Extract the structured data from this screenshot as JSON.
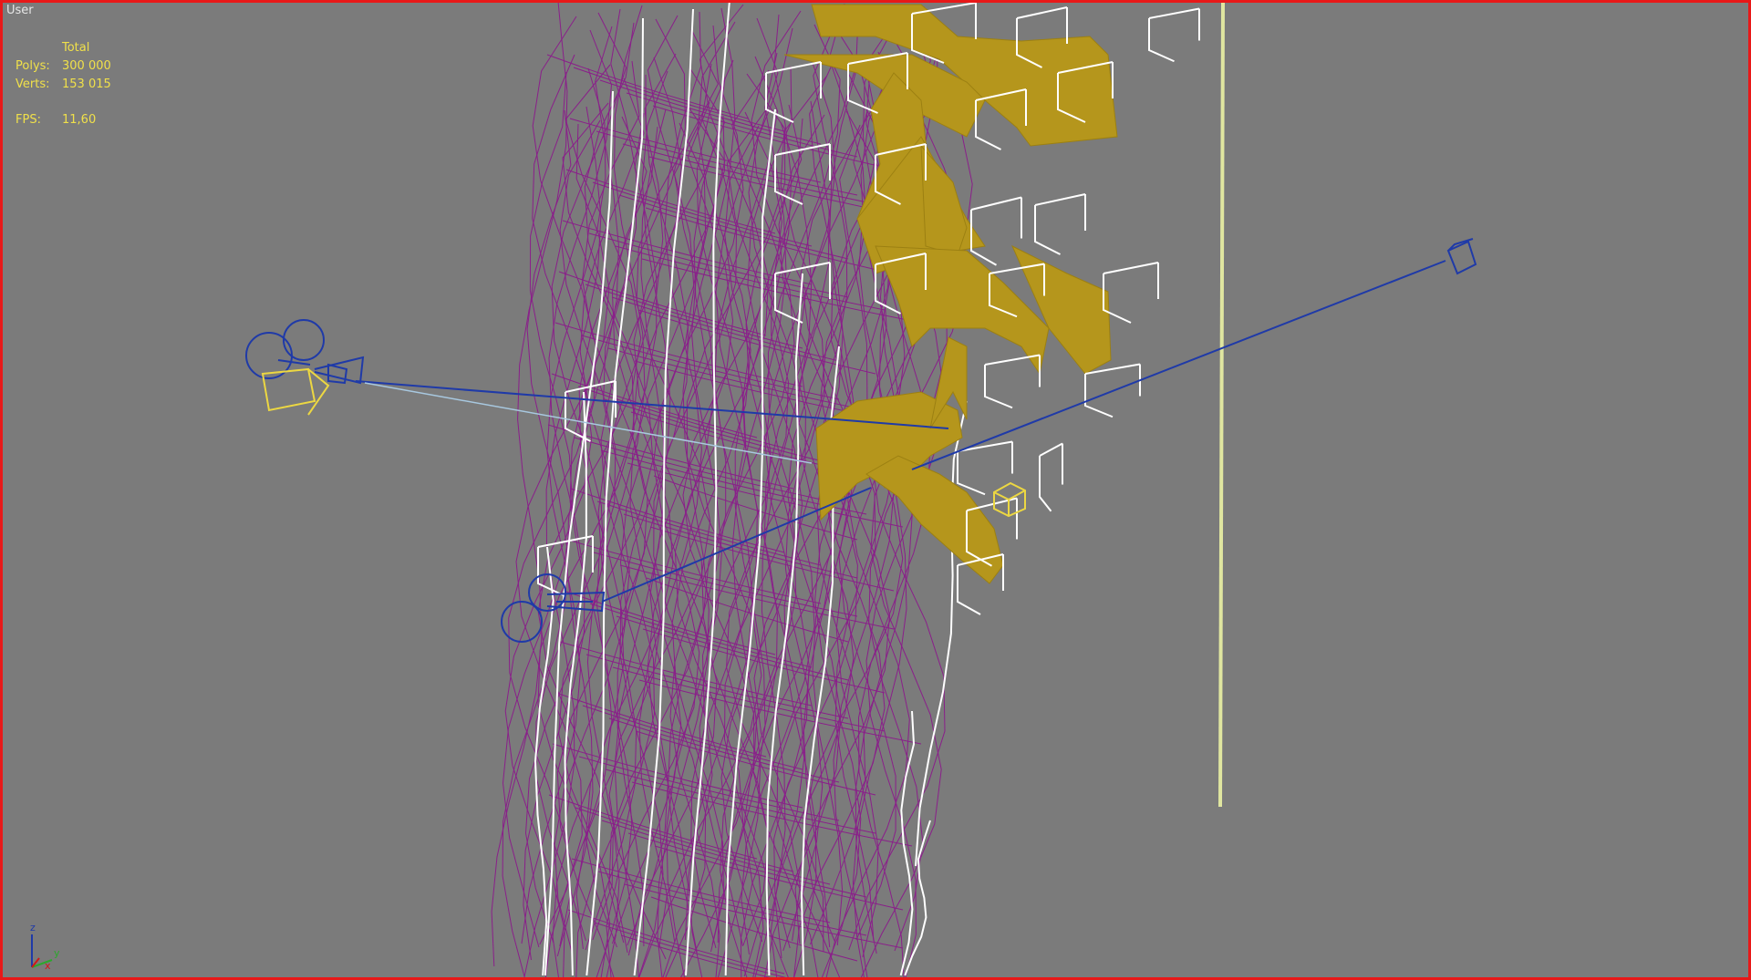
{
  "viewport": {
    "label": "User",
    "border_color": "#e81818",
    "background": "#7b7b7b",
    "active": true
  },
  "stats": {
    "header": "Total",
    "polys_label": "Polys:",
    "polys_value": "300 000",
    "verts_label": "Verts:",
    "verts_value": "153 015",
    "fps_label": "FPS:",
    "fps_value": "11,60",
    "text_color": "#f0e04a"
  },
  "axis_gizmo": {
    "z": "z",
    "y": "y",
    "x": "x"
  },
  "scene": {
    "wire_colors": {
      "tower_mesh": "#8a1f8a",
      "tower_outline": "#ffffff",
      "panels": "#b5961c",
      "lights": "#1f3aa8",
      "selected": "#ecd742",
      "target_line": "#1f3aa8",
      "ground_line": "#e0e6a0"
    },
    "objects": [
      "camera-icon",
      "camera-target-icon",
      "light-icon",
      "light-target-icon",
      "tower-wireframe",
      "golden-panels",
      "vertical-guide-line"
    ]
  }
}
